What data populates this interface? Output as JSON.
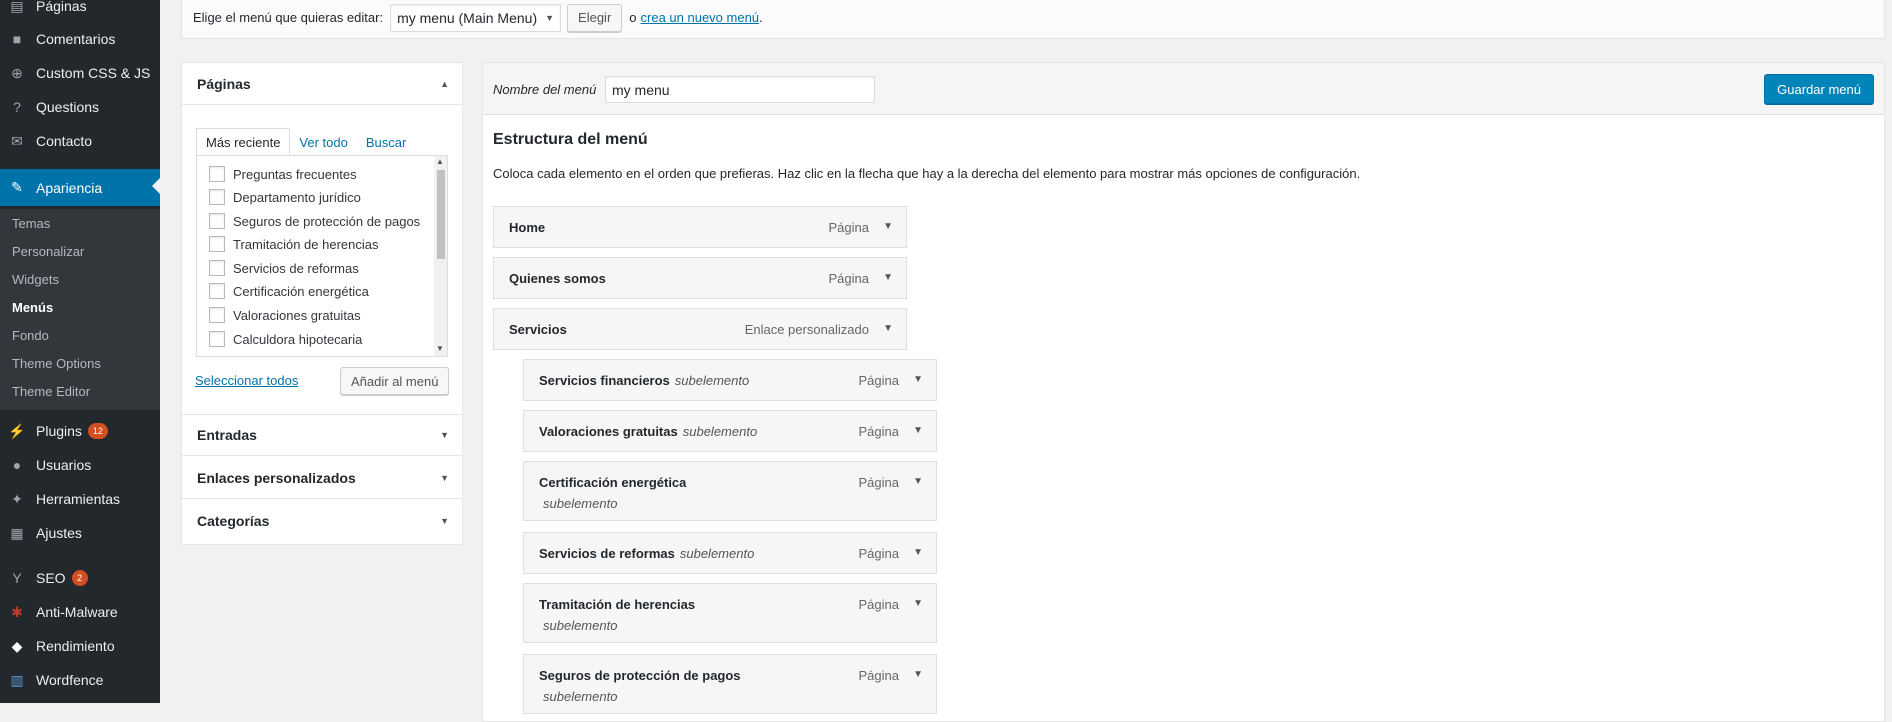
{
  "sidebar": {
    "items": [
      {
        "label": "Páginas",
        "icon": "pages-icon"
      },
      {
        "label": "Comentarios",
        "icon": "comment-icon"
      },
      {
        "label": "Custom CSS & JS",
        "icon": "plus-circle-icon"
      },
      {
        "label": "Questions",
        "icon": "question-icon"
      },
      {
        "label": "Contacto",
        "icon": "mail-icon"
      },
      {
        "label": "Apariencia",
        "icon": "brush-icon"
      },
      {
        "label": "Plugins",
        "icon": "plugin-icon",
        "badge": "12"
      },
      {
        "label": "Usuarios",
        "icon": "user-icon"
      },
      {
        "label": "Herramientas",
        "icon": "wrench-icon"
      },
      {
        "label": "Ajustes",
        "icon": "settings-icon"
      },
      {
        "label": "SEO",
        "icon": "yoast-icon",
        "badge": "2"
      },
      {
        "label": "Anti-Malware",
        "icon": "shield-icon"
      },
      {
        "label": "Rendimiento",
        "icon": "cube-icon"
      },
      {
        "label": "Wordfence",
        "icon": "wordfence-icon"
      }
    ],
    "submenu": [
      "Temas",
      "Personalizar",
      "Widgets",
      "Menús",
      "Fondo",
      "Theme Options",
      "Theme Editor"
    ],
    "accent": "#0073aa",
    "background": "#23282d"
  },
  "manage": {
    "label": "Elige el menú que quieras editar:",
    "selected_menu": "my menu (Main Menu)",
    "choose_button": "Elegir",
    "or_text": "o",
    "create_link": "crea un nuevo menú",
    "period": "."
  },
  "accordion": {
    "pages_title": "Páginas",
    "tabs": [
      "Más reciente",
      "Ver todo",
      "Buscar"
    ],
    "pages": [
      "Preguntas frecuentes",
      "Departamento jurídico",
      "Seguros de protección de pagos",
      "Tramitación de herencias",
      "Servicios de reformas",
      "Certificación energética",
      "Valoraciones gratuitas",
      "Calculdora hipotecaria"
    ],
    "select_all": "Seleccionar todos",
    "add_button": "Añadir al menú",
    "sections": [
      "Entradas",
      "Enlaces personalizados",
      "Categorías"
    ]
  },
  "menu": {
    "name_label": "Nombre del menú",
    "name_value": "my menu",
    "save_button": "Guardar menú",
    "structure_title": "Estructura del menú",
    "structure_desc": "Coloca cada elemento en el orden que prefieras. Haz clic en la flecha que hay a la derecha del elemento para mostrar más opciones de configuración.",
    "sub_label": "subelemento",
    "items": [
      {
        "title": "Home",
        "type": "Página"
      },
      {
        "title": "Quienes somos",
        "type": "Página"
      },
      {
        "title": "Servicios",
        "type": "Enlace personalizado"
      },
      {
        "title": "Servicios financieros",
        "type": "Página"
      },
      {
        "title": "Valoraciones gratuitas",
        "type": "Página"
      },
      {
        "title": "Certificación energética",
        "type": "Página"
      },
      {
        "title": "Servicios de reformas",
        "type": "Página"
      },
      {
        "title": "Tramitación de herencias",
        "type": "Página"
      },
      {
        "title": "Seguros de protección de pagos",
        "type": "Página"
      }
    ]
  }
}
